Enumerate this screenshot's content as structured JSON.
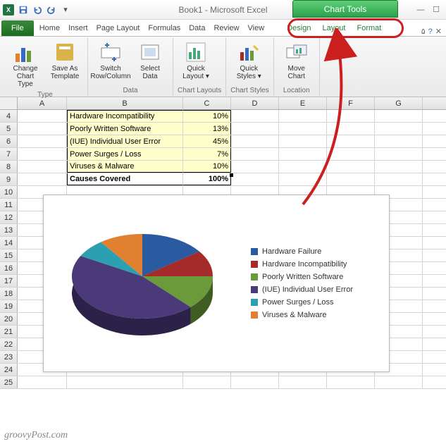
{
  "window": {
    "title": "Book1 - Microsoft Excel",
    "chart_tools": "Chart Tools"
  },
  "tabs": {
    "file": "File",
    "list": [
      "Home",
      "Insert",
      "Page Layout",
      "Formulas",
      "Data",
      "Review",
      "View"
    ],
    "chart": [
      "Design",
      "Layout",
      "Format"
    ]
  },
  "ribbon": {
    "change_chart_type": "Change Chart Type",
    "save_as_template": "Save As Template",
    "type_group": "Type",
    "switch_row_col": "Switch Row/Column",
    "select_data": "Select Data",
    "data_group": "Data",
    "quick_layout": "Quick Layout",
    "chart_layouts": "Chart Layouts",
    "quick_styles": "Quick Styles",
    "chart_styles": "Chart Styles",
    "move_chart": "Move Chart",
    "location": "Location"
  },
  "columns": [
    "A",
    "B",
    "C",
    "D",
    "E",
    "F",
    "G"
  ],
  "rows_start": 4,
  "table": {
    "rows": [
      {
        "label": "Hardware Incompatibility",
        "value": "10%"
      },
      {
        "label": "Poorly Written Software",
        "value": "13%"
      },
      {
        "label": "(IUE) Individual User Error",
        "value": "45%"
      },
      {
        "label": "Power Surges / Loss",
        "value": "7%"
      },
      {
        "label": "Viruses & Malware",
        "value": "10%"
      }
    ],
    "total_label": "Causes Covered",
    "total_value": "100%"
  },
  "chart_data": {
    "type": "pie",
    "categories": [
      "Hardware Failure",
      "Hardware Incompatibility",
      "Poorly Written Software",
      "(IUE) Individual User Error",
      "Power Surges / Loss",
      "Viruses & Malware"
    ],
    "values": [
      15,
      10,
      13,
      45,
      7,
      10
    ],
    "colors": [
      "#2a5aa0",
      "#a52a2a",
      "#6a9a3a",
      "#4a3a7a",
      "#2aa0b0",
      "#e08030"
    ],
    "title": "",
    "xlabel": "",
    "ylabel": ""
  },
  "watermark": "groovyPost.com"
}
